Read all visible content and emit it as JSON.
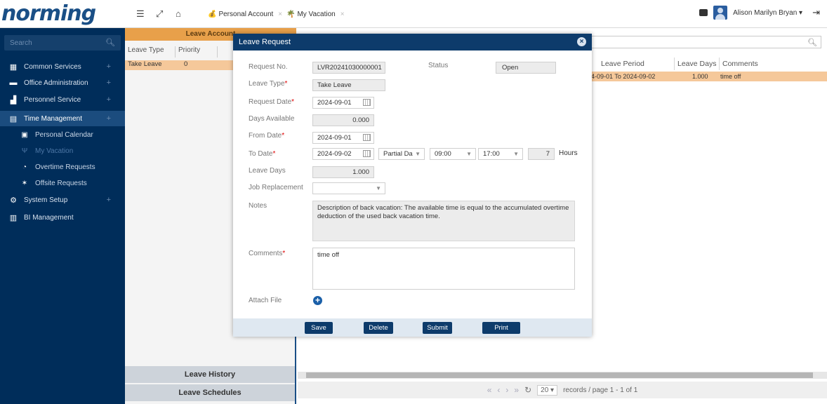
{
  "app": {
    "logo": "norming"
  },
  "topbar": {
    "tabs": [
      {
        "label": "Personal Account"
      },
      {
        "label": "My Vacation"
      }
    ],
    "user_name": "Alison Marilyn Bryan ▾"
  },
  "sidebar": {
    "search_placeholder": "Search",
    "items": [
      {
        "label": "Common Services"
      },
      {
        "label": "Office Administration"
      },
      {
        "label": "Personnel Service"
      },
      {
        "label": "Time Management"
      },
      {
        "label": "System Setup"
      },
      {
        "label": "BI Management"
      }
    ],
    "sub_items": [
      {
        "label": "Personal Calendar"
      },
      {
        "label": "My Vacation"
      },
      {
        "label": "Overtime Requests"
      },
      {
        "label": "Offsite Requests"
      }
    ]
  },
  "left_panel": {
    "header": "Leave Account",
    "columns": [
      "Leave Type",
      "Priority"
    ],
    "rows": [
      {
        "leave_type": "Take Leave",
        "priority": "0"
      }
    ],
    "footer_tabs": [
      "Leave History",
      "Leave Schedules"
    ]
  },
  "right_panel": {
    "columns": [
      "Leave Period",
      "Leave Days",
      "Comments"
    ],
    "row": {
      "leave_period": "4-09-01 To 2024-09-02",
      "leave_days": "1.000",
      "comments": "time off"
    },
    "pager": {
      "page_size": "20",
      "records_label": "records / page  1 - 1 of 1"
    }
  },
  "modal": {
    "title": "Leave Request",
    "labels": {
      "request_no": "Request No.",
      "status": "Status",
      "leave_type": "Leave Type",
      "request_date": "Request Date",
      "days_available": "Days Available",
      "from_date": "From Date",
      "to_date": "To Date",
      "leave_days": "Leave Days",
      "job_replacement": "Job Replacement",
      "notes": "Notes",
      "comments": "Comments",
      "attach_file": "Attach File",
      "hours": "Hours"
    },
    "values": {
      "request_no": "LVR20241030000001",
      "status": "Open",
      "leave_type": "Take Leave",
      "request_date": "2024-09-01",
      "days_available": "0.000",
      "from_date": "2024-09-01",
      "to_date": "2024-09-02",
      "partial_day": "Partial Da",
      "start_time": "09:00",
      "end_time": "17:00",
      "hours": "7",
      "leave_days": "1.000",
      "job_replacement": "",
      "notes": "Description of back vacation: The available time is equal to the accumulated overtime deduction of the used back vacation time.",
      "comments": "time off"
    },
    "buttons": {
      "save": "Save",
      "delete": "Delete",
      "submit": "Submit",
      "print": "Print"
    }
  }
}
